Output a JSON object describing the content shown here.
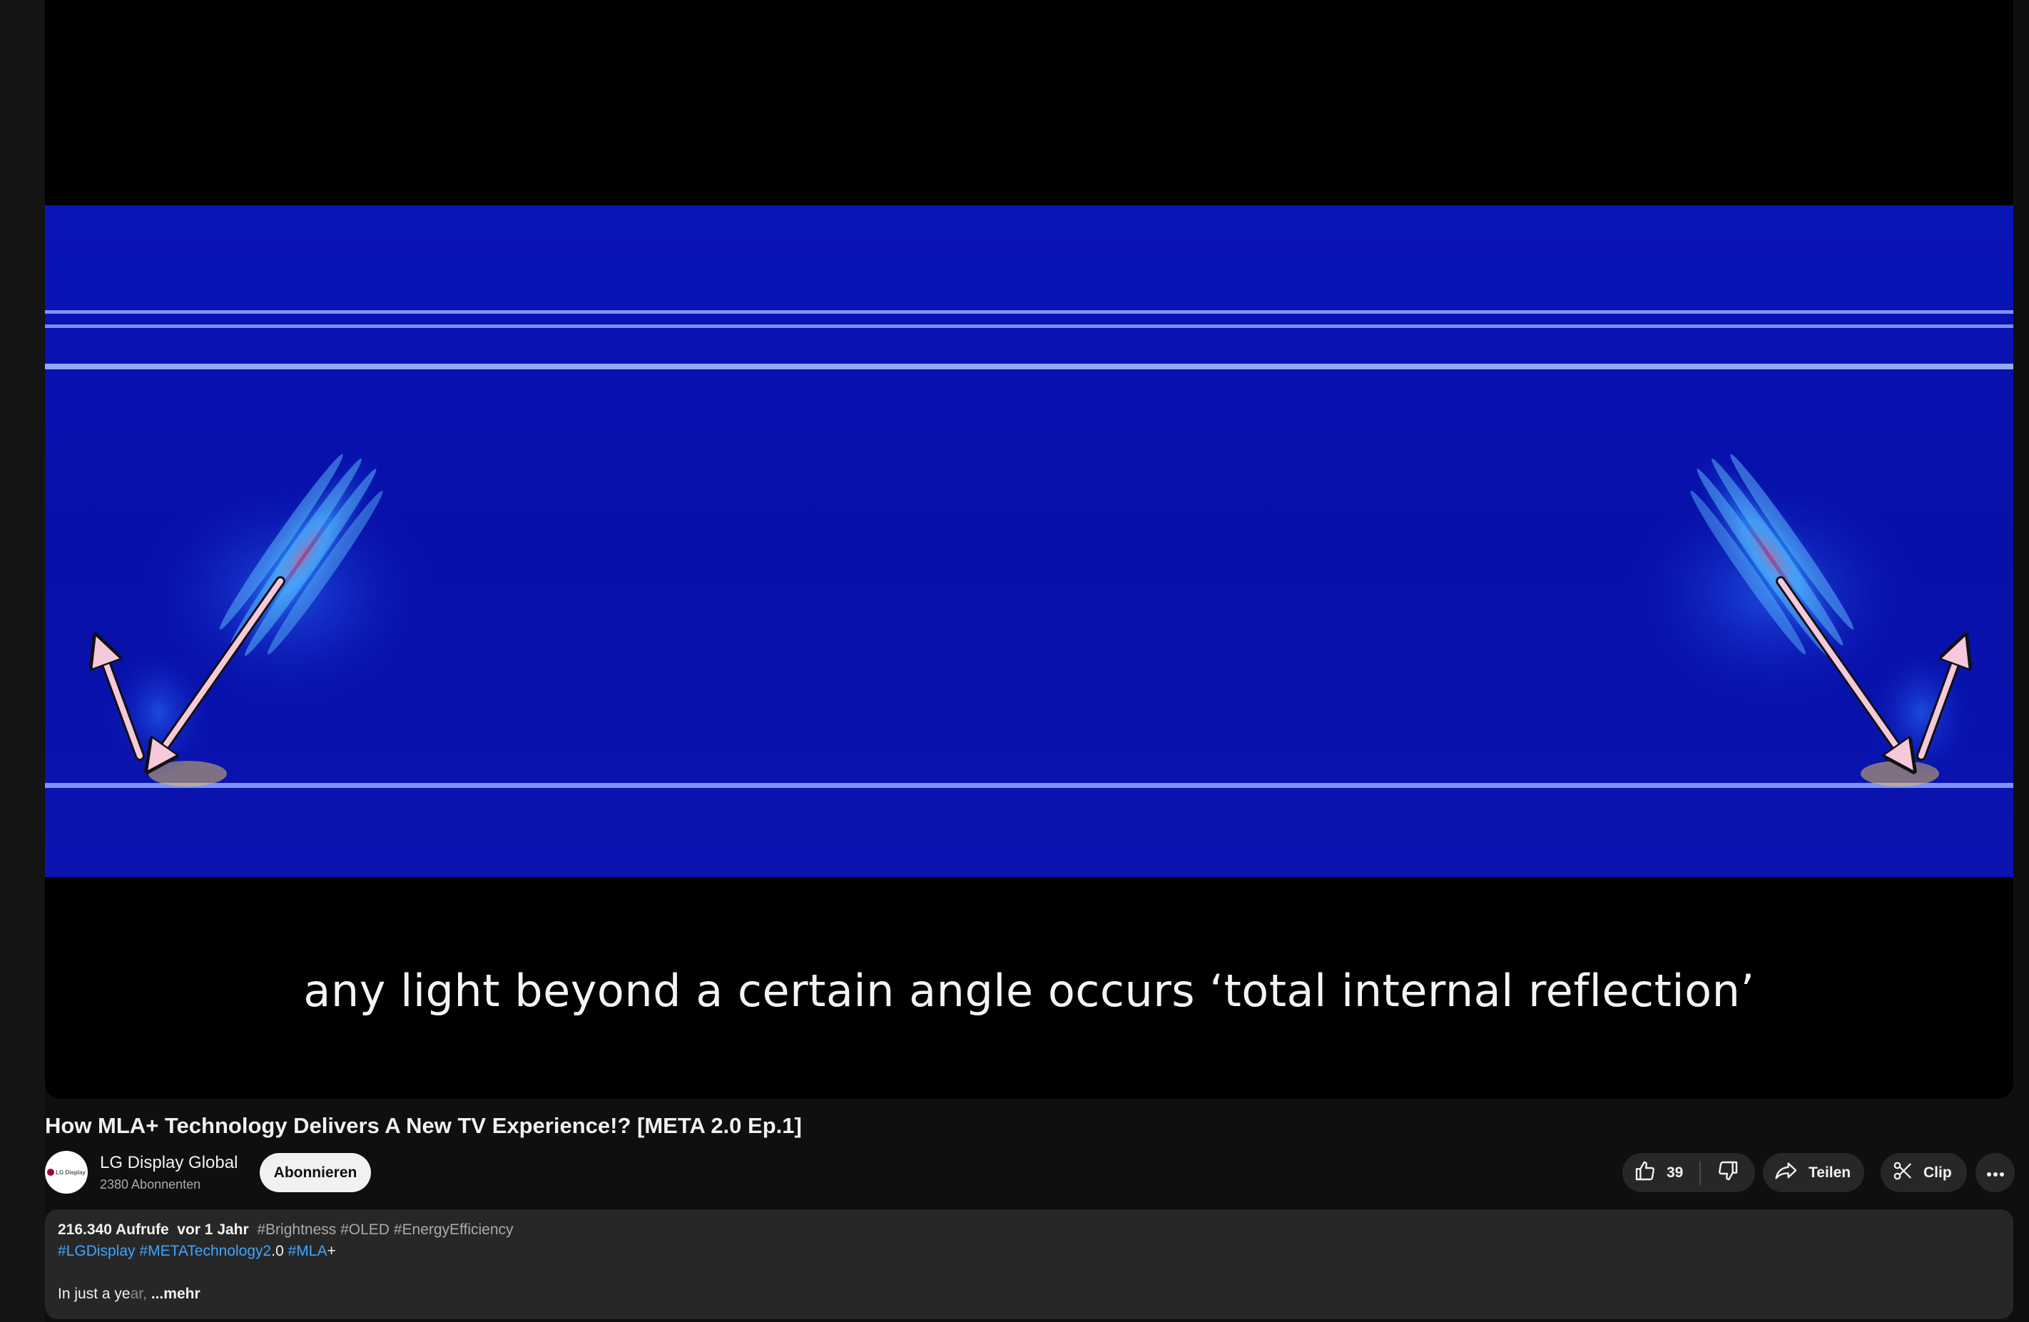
{
  "player": {
    "caption": "any light beyond a certain angle occurs ‘total internal reflection’"
  },
  "video": {
    "title": "How MLA+ Technology Delivers A New TV Experience!? [META 2.0 Ep.1]"
  },
  "channel": {
    "name": "LG Display Global",
    "subscribers": "2380 Abonnenten",
    "avatar_text": "LG Display",
    "subscribe_label": "Abonnieren"
  },
  "actions": {
    "like_count": "39",
    "share_label": "Teilen",
    "clip_label": "Clip",
    "icons": [
      "thumbs-up-icon",
      "thumbs-down-icon",
      "share-icon",
      "scissors-icon",
      "more-icon"
    ]
  },
  "description": {
    "views": "216.340 Aufrufe",
    "age": "vor 1 Jahr",
    "tags_line1": [
      "#Brightness",
      "#OLED",
      "#EnergyEfficiency"
    ],
    "tag_lgdisplay": "#LGDisplay",
    "tag_meta": "#METATechnology2",
    "tag_meta_suffix": ".0",
    "tag_mla": "#MLA",
    "tag_mla_suffix": "+",
    "text_visible": "In just a ye",
    "text_faded": "ar,",
    "more_label": "...mehr"
  },
  "colors": {
    "background": "#0f0f0f",
    "surface": "#272727",
    "link": "#3ea6ff",
    "video_blue": "#0a14b4"
  }
}
